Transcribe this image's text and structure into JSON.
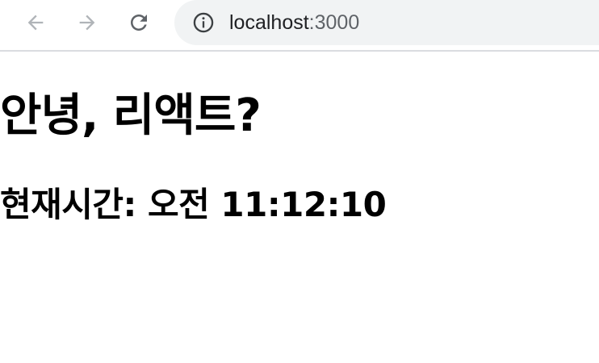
{
  "browser": {
    "url_host": "localhost",
    "url_port": ":3000",
    "icons": {
      "back": "arrow-left-icon",
      "forward": "arrow-right-icon",
      "reload": "reload-icon",
      "site_info": "info-icon"
    },
    "colors": {
      "toolbar_bg": "#ffffff",
      "omnibox_bg": "#f1f3f4",
      "icon_disabled": "#9aa0a6",
      "icon_active": "#5f6368"
    }
  },
  "content": {
    "heading": "안녕, 리액트?",
    "time_label": "현재시간: 오전 11:12:10"
  }
}
